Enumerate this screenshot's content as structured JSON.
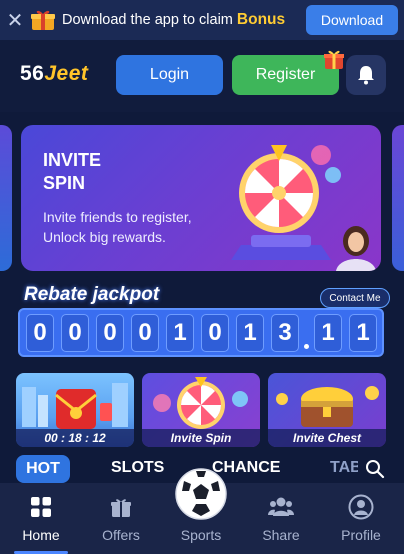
{
  "promo": {
    "message": "Download the app to claim",
    "bonus": "Bonus",
    "download_label": "Download"
  },
  "header": {
    "logo_number": "56",
    "logo_name": "Jeet",
    "login_label": "Login",
    "register_label": "Register"
  },
  "banner": {
    "title_line1": "INVITE",
    "title_line2": "SPIN",
    "subtitle_line1": "Invite friends to register,",
    "subtitle_line2": "Unlock big rewards."
  },
  "jackpot": {
    "title": "Rebate jackpot",
    "contact_label": "Contact Me",
    "digits": [
      "0",
      "0",
      "0",
      "0",
      "1",
      "0",
      "1",
      "3",
      "1",
      "1"
    ]
  },
  "tiles": [
    {
      "caption": "00 : 18 : 12"
    },
    {
      "caption": "Invite Spin"
    },
    {
      "caption": "Invite Chest"
    }
  ],
  "categories": {
    "hot": "HOT",
    "slots": "SLOTS",
    "chance": "CHANCE",
    "table": "TAB"
  },
  "nav": {
    "home": "Home",
    "offers": "Offers",
    "sports": "Sports",
    "share": "Share",
    "profile": "Profile"
  },
  "colors": {
    "primary": "#2f74e0",
    "register": "#3eb65a",
    "bonus": "#ffcc33",
    "background": "#0f1a3a"
  }
}
